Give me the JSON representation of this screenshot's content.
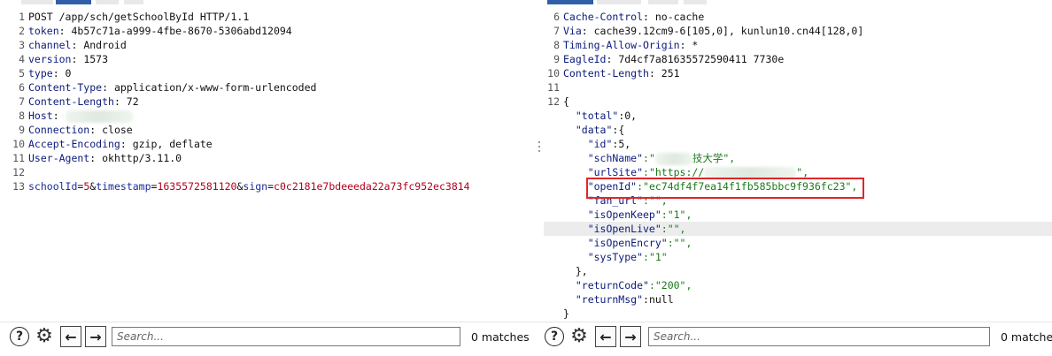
{
  "request": {
    "lines": [
      {
        "n": "1",
        "parts": [
          {
            "t": "POST /app/sch/getSchoolById HTTP/1.1",
            "c": ""
          }
        ]
      },
      {
        "n": "2",
        "parts": [
          {
            "t": "token",
            "c": "key"
          },
          {
            "t": ": 4b57c71a-a999-4fbe-8670-5306abd12094",
            "c": ""
          }
        ]
      },
      {
        "n": "3",
        "parts": [
          {
            "t": "channel",
            "c": "key"
          },
          {
            "t": ": Android",
            "c": ""
          }
        ]
      },
      {
        "n": "4",
        "parts": [
          {
            "t": "version",
            "c": "key"
          },
          {
            "t": ": 1573",
            "c": ""
          }
        ]
      },
      {
        "n": "5",
        "parts": [
          {
            "t": "type",
            "c": "key"
          },
          {
            "t": ": 0",
            "c": ""
          }
        ]
      },
      {
        "n": "6",
        "parts": [
          {
            "t": "Content-Type",
            "c": "key"
          },
          {
            "t": ": application/x-www-form-urlencoded",
            "c": ""
          }
        ]
      },
      {
        "n": "7",
        "parts": [
          {
            "t": "Content-Length",
            "c": "key"
          },
          {
            "t": ": 72",
            "c": ""
          }
        ]
      },
      {
        "n": "8",
        "parts": [
          {
            "t": "Host",
            "c": "key"
          },
          {
            "t": ": ",
            "c": ""
          },
          {
            "blur": 76
          }
        ]
      },
      {
        "n": "9",
        "parts": [
          {
            "t": "Connection",
            "c": "key"
          },
          {
            "t": ": close",
            "c": ""
          }
        ]
      },
      {
        "n": "10",
        "parts": [
          {
            "t": "Accept-Encoding",
            "c": "key"
          },
          {
            "t": ": gzip, deflate",
            "c": ""
          }
        ]
      },
      {
        "n": "11",
        "parts": [
          {
            "t": "User-Agent",
            "c": "key"
          },
          {
            "t": ": okhttp/3.11.0",
            "c": ""
          }
        ]
      },
      {
        "n": "12",
        "parts": []
      },
      {
        "n": "13",
        "parts": [
          {
            "t": "schoolId",
            "c": "bl"
          },
          {
            "t": "=",
            "c": ""
          },
          {
            "t": "5",
            "c": "red"
          },
          {
            "t": "&",
            "c": ""
          },
          {
            "t": "timestamp",
            "c": "bl"
          },
          {
            "t": "=",
            "c": ""
          },
          {
            "t": "1635572581120",
            "c": "red"
          },
          {
            "t": "&",
            "c": ""
          },
          {
            "t": "sign",
            "c": "bl"
          },
          {
            "t": "=",
            "c": ""
          },
          {
            "t": "c0c2181e7bdeeeda22a73fc952ec3814",
            "c": "red"
          }
        ]
      }
    ],
    "search_placeholder": "Search...",
    "matches_label": "0 matches"
  },
  "response": {
    "lines": [
      {
        "n": "6",
        "parts": [
          {
            "t": "Cache-Control",
            "c": "key"
          },
          {
            "t": ": no-cache",
            "c": ""
          }
        ]
      },
      {
        "n": "7",
        "parts": [
          {
            "t": "Via",
            "c": "key"
          },
          {
            "t": ": cache39.12cm9-6[105,0], kunlun10.cn44[128,0]",
            "c": ""
          }
        ]
      },
      {
        "n": "8",
        "parts": [
          {
            "t": "Timing-Allow-Origin",
            "c": "key"
          },
          {
            "t": ": *",
            "c": ""
          }
        ]
      },
      {
        "n": "9",
        "parts": [
          {
            "t": "EagleId",
            "c": "key"
          },
          {
            "t": ": 7d4cf7a81635572590411 7730e",
            "c": ""
          }
        ]
      },
      {
        "n": "10",
        "parts": [
          {
            "t": "Content-Length",
            "c": "key"
          },
          {
            "t": ": 251",
            "c": ""
          }
        ]
      },
      {
        "n": "11",
        "parts": []
      },
      {
        "n": "12",
        "parts": [
          {
            "t": "{",
            "c": ""
          }
        ]
      },
      {
        "n": "",
        "parts": [
          {
            "t": "  \"total\"",
            "c": "key"
          },
          {
            "t": ":0,",
            "c": ""
          }
        ]
      },
      {
        "n": "",
        "parts": [
          {
            "t": "  \"data\"",
            "c": "key"
          },
          {
            "t": ":{",
            "c": ""
          }
        ]
      },
      {
        "n": "",
        "parts": [
          {
            "t": "    \"id\"",
            "c": "key"
          },
          {
            "t": ":5,",
            "c": ""
          }
        ]
      },
      {
        "n": "",
        "parts": [
          {
            "t": "    \"schName\"",
            "c": "key"
          },
          {
            "t": ":\"",
            "c": "grn"
          },
          {
            "blur": 42
          },
          {
            "t": "技大学\",",
            "c": "grn"
          }
        ]
      },
      {
        "n": "",
        "parts": [
          {
            "t": "    \"urlSite\"",
            "c": "key"
          },
          {
            "t": ":\"https://",
            "c": "grn"
          },
          {
            "blur": 104
          },
          {
            "t": "\",",
            "c": "grn"
          }
        ]
      },
      {
        "n": "",
        "parts": [
          {
            "t": "    \"openId\"",
            "c": "key"
          },
          {
            "t": ":\"ec74df4f7ea14f1fb585bbc9f936fc23\",",
            "c": "grn"
          }
        ]
      },
      {
        "n": "",
        "parts": [
          {
            "t": "    \"fan_url\"",
            "c": "key"
          },
          {
            "t": ":\"\",",
            "c": "grn"
          }
        ]
      },
      {
        "n": "",
        "parts": [
          {
            "t": "    \"isOpenKeep\"",
            "c": "key"
          },
          {
            "t": ":\"1\",",
            "c": "grn"
          }
        ]
      },
      {
        "n": "",
        "parts": [
          {
            "t": "    \"isOpenLive\"",
            "c": "key"
          },
          {
            "t": ":\"\",",
            "c": "grn"
          }
        ],
        "hl": true
      },
      {
        "n": "",
        "parts": [
          {
            "t": "    \"isOpenEncry\"",
            "c": "key"
          },
          {
            "t": ":\"\",",
            "c": "grn"
          }
        ]
      },
      {
        "n": "",
        "parts": [
          {
            "t": "    \"sysType\"",
            "c": "key"
          },
          {
            "t": ":\"1\"",
            "c": "grn"
          }
        ]
      },
      {
        "n": "",
        "parts": [
          {
            "t": "  },",
            "c": ""
          }
        ]
      },
      {
        "n": "",
        "parts": [
          {
            "t": "  \"returnCode\"",
            "c": "key"
          },
          {
            "t": ":\"200\",",
            "c": "grn"
          }
        ]
      },
      {
        "n": "",
        "parts": [
          {
            "t": "  \"returnMsg\"",
            "c": "key"
          },
          {
            "t": ":null",
            "c": ""
          }
        ]
      },
      {
        "n": "",
        "parts": [
          {
            "t": "}",
            "c": ""
          }
        ]
      }
    ],
    "search_placeholder": "Search...",
    "matches_label": "0 matche"
  },
  "icons": {
    "help": "?",
    "settings": "⚙",
    "prev": "←",
    "next": "→"
  },
  "colors": {
    "highlight_box": "#e0262a",
    "tab_active": "#2f5fa8",
    "string_value": "#1a7a1a",
    "param_value": "#b0001d"
  }
}
